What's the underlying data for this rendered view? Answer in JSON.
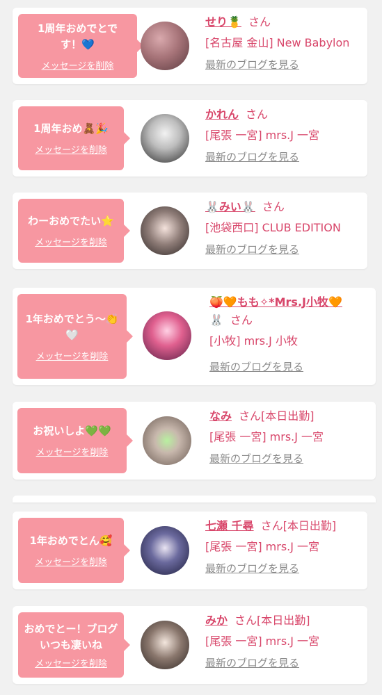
{
  "delete_label": "メッセージを削除",
  "blog_label": "最新のブログを見る",
  "san": "さん",
  "colors": {
    "bubble": "#f797a1",
    "accent": "#d8466a",
    "link_gray": "#8a8a8a"
  },
  "cards": [
    {
      "message": "1周年おめでとです！💙",
      "name": "せり🍍",
      "name_suffix": "",
      "shop": "[名古屋 金山] New Babylon"
    },
    {
      "message": "1周年おめ🧸🎉",
      "name": "かれん",
      "name_suffix": "",
      "shop": "[尾張 一宮] mrs.J 一宮"
    },
    {
      "message": "わーおめでたい⭐",
      "name": "🐰みい🐰",
      "name_suffix": "",
      "shop": "[池袋西口] CLUB EDITION"
    },
    {
      "message": "1年おめでとう〜👏🤍",
      "name": "🍑🧡もも✧*Mrs.J小牧🧡",
      "name_line2": "🐰",
      "name_suffix": "",
      "shop": "[小牧] mrs.J 小牧"
    },
    {
      "message": "お祝いしよ💚💚",
      "name": "なみ",
      "name_suffix": "[本日出勤]",
      "shop": "[尾張 一宮] mrs.J 一宮"
    },
    {
      "message": "1年おめでとん🥰",
      "name": "七瀬 千尋",
      "name_suffix": "[本日出勤]",
      "shop": "[尾張 一宮] mrs.J 一宮"
    },
    {
      "message": "おめでとー！ブログいつも凄いね",
      "name": "みか",
      "name_suffix": "[本日出勤]",
      "shop": "[尾張 一宮] mrs.J 一宮"
    }
  ]
}
